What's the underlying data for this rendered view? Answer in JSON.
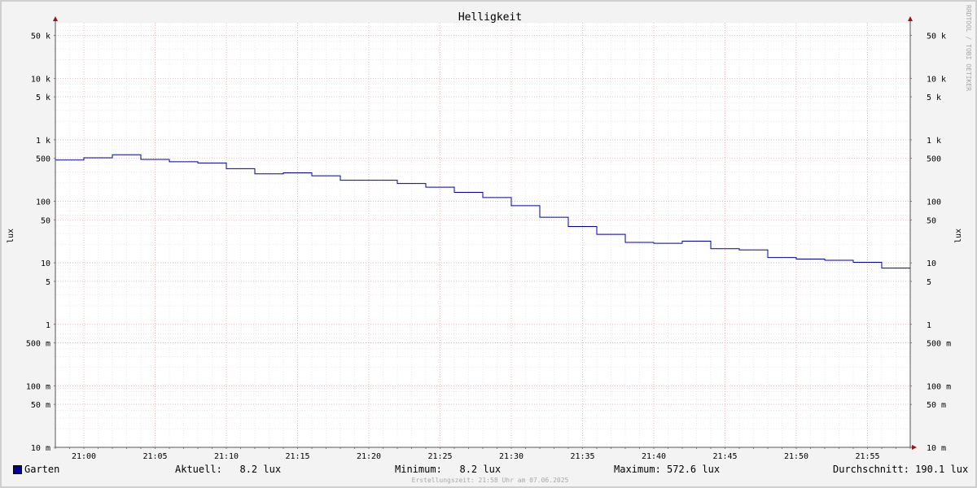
{
  "chart_data": {
    "type": "line",
    "title": "Helligkeit",
    "ylabel": "lux",
    "yscale": "log",
    "ylim": [
      0.01,
      80000
    ],
    "xlim": [
      "20:58",
      "21:58"
    ],
    "grid": true,
    "y_ticks": [
      {
        "v": 0.01,
        "t": "10 m"
      },
      {
        "v": 0.05,
        "t": "50 m"
      },
      {
        "v": 0.1,
        "t": "100 m"
      },
      {
        "v": 0.5,
        "t": "500 m"
      },
      {
        "v": 1,
        "t": "1"
      },
      {
        "v": 5,
        "t": "5"
      },
      {
        "v": 10,
        "t": "10"
      },
      {
        "v": 50,
        "t": "50"
      },
      {
        "v": 100,
        "t": "100"
      },
      {
        "v": 500,
        "t": "500"
      },
      {
        "v": 1000,
        "t": "1 k"
      },
      {
        "v": 5000,
        "t": "5 k"
      },
      {
        "v": 10000,
        "t": "10 k"
      },
      {
        "v": 50000,
        "t": "50 k"
      }
    ],
    "x_ticks": [
      "21:00",
      "21:05",
      "21:10",
      "21:15",
      "21:20",
      "21:25",
      "21:30",
      "21:35",
      "21:40",
      "21:45",
      "21:50",
      "21:55"
    ],
    "series": [
      {
        "name": "Garten",
        "color": "#0000a0",
        "step": true,
        "points": [
          [
            "20:58",
            470
          ],
          [
            "21:00",
            510
          ],
          [
            "21:02",
            572.6
          ],
          [
            "21:04",
            480
          ],
          [
            "21:06",
            440
          ],
          [
            "21:08",
            420
          ],
          [
            "21:10",
            340
          ],
          [
            "21:12",
            280
          ],
          [
            "21:14",
            290
          ],
          [
            "21:16",
            260
          ],
          [
            "21:18",
            220
          ],
          [
            "21:20",
            220
          ],
          [
            "21:22",
            195
          ],
          [
            "21:24",
            170
          ],
          [
            "21:26",
            140
          ],
          [
            "21:28",
            115
          ],
          [
            "21:30",
            85
          ],
          [
            "21:32",
            55
          ],
          [
            "21:34",
            39
          ],
          [
            "21:36",
            29
          ],
          [
            "21:38",
            21.5
          ],
          [
            "21:40",
            20.8
          ],
          [
            "21:42",
            22.5
          ],
          [
            "21:44",
            17
          ],
          [
            "21:46",
            16.2
          ],
          [
            "21:48",
            12.2
          ],
          [
            "21:50",
            11.5
          ],
          [
            "21:52",
            11
          ],
          [
            "21:54",
            10.2
          ],
          [
            "21:56",
            8.2
          ],
          [
            "21:58",
            8.2
          ]
        ]
      }
    ]
  },
  "legend": {
    "series_name": "Garten",
    "current": "Aktuell:   8.2 lux",
    "minimum": "Minimum:   8.2 lux",
    "maximum": "Maximum: 572.6 lux",
    "average": "Durchschnitt: 190.1 lux"
  },
  "footer": "Erstellungszeit: 21:58 Uhr am 07.06.2025",
  "side_watermark": "RRDTOOL / TOBI OETIKER"
}
